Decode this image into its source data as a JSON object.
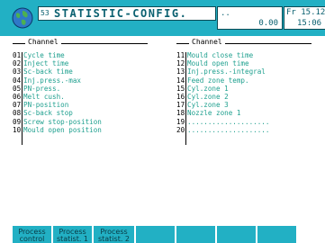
{
  "header": {
    "page_number": "53",
    "title": "STATISTIC-CONFIG.",
    "value_dots": "..",
    "value": "0.00",
    "date": "Fr 15.12.0",
    "time": "15:06 S"
  },
  "left_panel": {
    "heading": "Channel",
    "rows": [
      {
        "num": "01",
        "label": "Cycle time"
      },
      {
        "num": "02",
        "label": "Inject time"
      },
      {
        "num": "03",
        "label": "Sc-back time"
      },
      {
        "num": "04",
        "label": "Inj.press.-max"
      },
      {
        "num": "05",
        "label": "PN-press."
      },
      {
        "num": "06",
        "label": "Melt cush."
      },
      {
        "num": "07",
        "label": "PN-position"
      },
      {
        "num": "08",
        "label": "Sc-back stop"
      },
      {
        "num": "09",
        "label": "Screw stop-position"
      },
      {
        "num": "10",
        "label": "Mould open position"
      }
    ]
  },
  "right_panel": {
    "heading": "Channel",
    "rows": [
      {
        "num": "11",
        "label": "Mould close time"
      },
      {
        "num": "12",
        "label": "Mould open time"
      },
      {
        "num": "13",
        "label": "Inj.press.-integral"
      },
      {
        "num": "14",
        "label": "Feed zone temp."
      },
      {
        "num": "15",
        "label": "Cyl.zone 1"
      },
      {
        "num": "16",
        "label": "Cyl.zone 2"
      },
      {
        "num": "17",
        "label": "Cyl.zone 3"
      },
      {
        "num": "18",
        "label": "Nozzle zone 1"
      },
      {
        "num": "19",
        "label": "...................."
      },
      {
        "num": "20",
        "label": "...................."
      }
    ]
  },
  "softkeys": [
    {
      "label": "Process control"
    },
    {
      "label": "Process statist. 1"
    },
    {
      "label": "Process statist. 2"
    },
    {
      "label": ""
    },
    {
      "label": ""
    },
    {
      "label": ""
    },
    {
      "label": ""
    }
  ],
  "colors": {
    "header_bg": "#22b0c4",
    "item_text": "#1fa08f",
    "title_text": "#0a6070"
  },
  "icons": {
    "logo": "globe-icon"
  }
}
